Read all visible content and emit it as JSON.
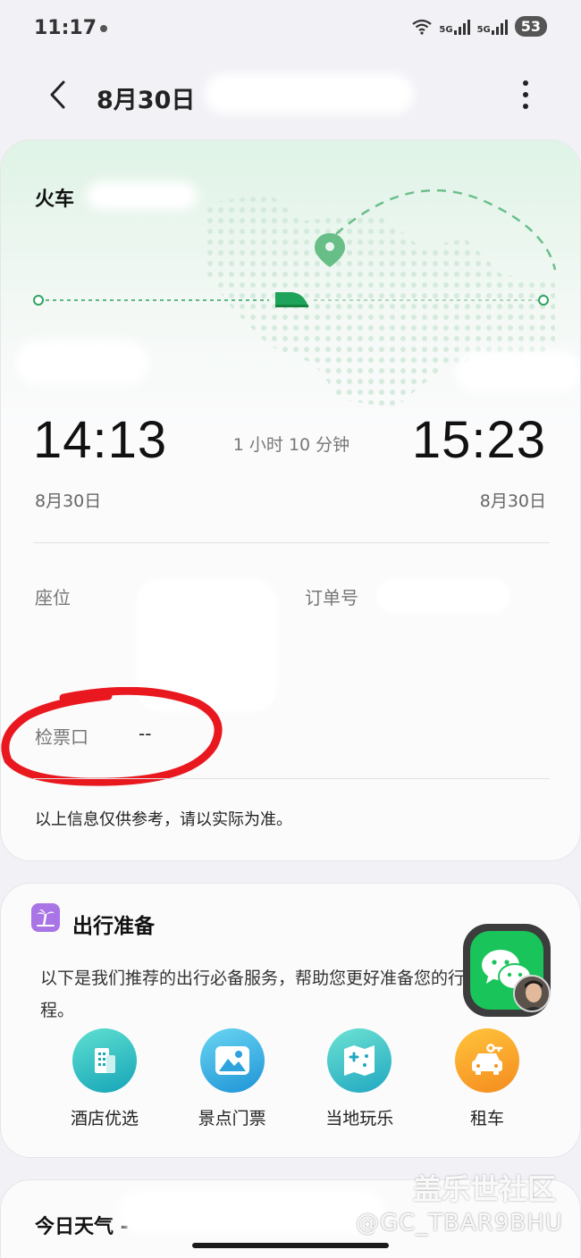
{
  "status_bar": {
    "time": "11:17",
    "network_1": "5G",
    "network_2": "5G",
    "battery": "53"
  },
  "header": {
    "title": "8月30日",
    "back_icon": "chevron-left-icon",
    "more_icon": "more-vertical-icon"
  },
  "ticket": {
    "type": "火车",
    "departure_time": "14:13",
    "arrival_time": "15:23",
    "duration": "1 小时 10 分钟",
    "departure_date": "8月30日",
    "arrival_date": "8月30日",
    "seat_label": "座位",
    "order_label": "订单号",
    "gate_label": "检票口",
    "gate_value": "--",
    "disclaimer": "以上信息仅供参考，请以实际为准。",
    "accent_color": "#1ea35a"
  },
  "prep": {
    "title": "出行准备",
    "description": "以下是我们推荐的出行必备服务，帮助您更好准备您的行程。",
    "services": [
      {
        "label": "酒店优选",
        "icon": "hotel-icon"
      },
      {
        "label": "景点门票",
        "icon": "landscape-icon"
      },
      {
        "label": "当地玩乐",
        "icon": "map-icon"
      },
      {
        "label": "租车",
        "icon": "car-icon"
      }
    ]
  },
  "weather": {
    "title": "今日天气 -"
  },
  "watermark": {
    "site": "盖乐世社区",
    "user": "@GC_TBAR9BHU"
  }
}
